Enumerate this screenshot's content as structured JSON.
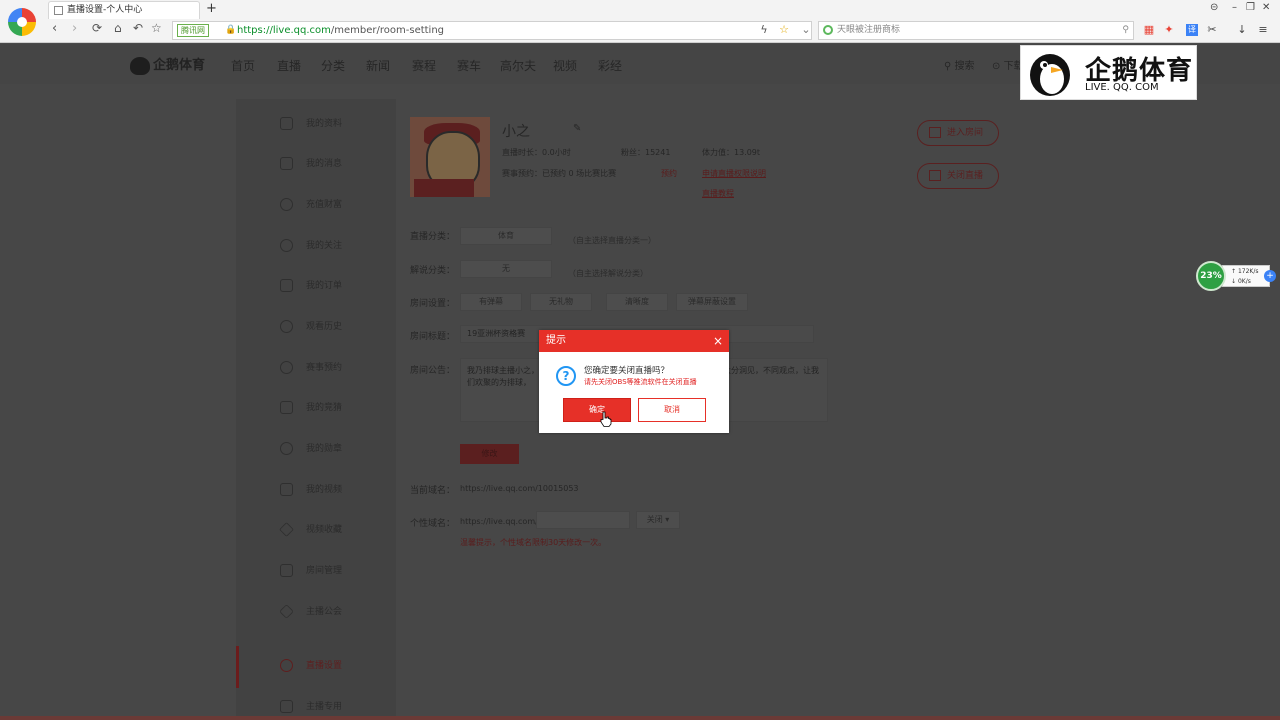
{
  "browser": {
    "tab_title": "直播设置-个人中心",
    "new_tab": "+",
    "safe_badge": "腾讯网",
    "url_host": "https://live.qq.com",
    "url_path": "/member/room-setting",
    "search_placeholder": "天眼被注册商标",
    "window_controls": [
      "⊝",
      "–",
      "❐",
      "✕"
    ],
    "toolbar_icons": [
      "bolt-icon",
      "star-icon",
      "dropdown-icon",
      "search-icon",
      "apps-icon",
      "game-icon",
      "translate-icon",
      "scissors-icon",
      "download-icon",
      "menu-icon"
    ]
  },
  "site": {
    "logo_text": "企鹅体育",
    "nav": [
      "首页",
      "直播",
      "分类",
      "新闻",
      "赛程",
      "赛车",
      "高尔夫",
      "视频",
      "彩经"
    ],
    "search_label": "搜索",
    "download_label": "下载"
  },
  "sidebar": {
    "items": [
      {
        "label": "我的资料",
        "icon": "user-icon"
      },
      {
        "label": "我的消息",
        "icon": "mail-icon"
      },
      {
        "label": "充值财富",
        "icon": "coin-icon"
      },
      {
        "label": "我的关注",
        "icon": "heart-icon"
      },
      {
        "label": "我的订单",
        "icon": "check-icon"
      },
      {
        "label": "观看历史",
        "icon": "clock-icon"
      },
      {
        "label": "赛事预约",
        "icon": "alarm-icon"
      },
      {
        "label": "我的竞猜",
        "icon": "trophy-icon"
      },
      {
        "label": "我的勋章",
        "icon": "badge-icon"
      },
      {
        "label": "我的视频",
        "icon": "play-icon"
      },
      {
        "label": "视频收藏",
        "icon": "star-icon"
      },
      {
        "label": "房间管理",
        "icon": "home-icon"
      },
      {
        "label": "主播公会",
        "icon": "diamond-icon"
      },
      {
        "label": "直播设置",
        "icon": "gear-icon",
        "active": true
      },
      {
        "label": "主播专用",
        "icon": "mic-icon"
      }
    ]
  },
  "profile": {
    "name": "小之",
    "duration": "直播时长：0.0小时",
    "fans": "粉丝：15241",
    "stamina": "体力值：13.09t",
    "appointment": "赛事预约：已预约 0 场比赛比赛",
    "cancel_appointment": "预约",
    "apply_link": "申请直播权限说明",
    "tutorial_link": "直播教程",
    "enter_room": "进入房间",
    "close_live": "关闭直播"
  },
  "form": {
    "category_label": "直播分类：",
    "category_value": "体育",
    "category_hint": "（自主选择直播分类一）",
    "commentary_label": "解说分类：",
    "commentary_value": "无",
    "commentary_hint": "（自主选择解说分类）",
    "room_settings_label": "房间设置：",
    "room_settings_options": [
      "有弹幕",
      "无礼物",
      "清晰度",
      "弹幕屏蔽设置"
    ],
    "title_label": "房间标题：",
    "title_value": "19亚洲杯资格赛",
    "notice_label": "房间公告：",
    "notice_text": "我乃排球主播小之，……中英排超联赛，以及王者教组篮球足球解说……大分洞见，不同观点，让我们欢聚的为排球，",
    "modify_button": "修改",
    "current_domain_label": "当前域名：",
    "current_domain_value": "https://live.qq.com/10015053",
    "custom_domain_label": "个性域名：",
    "custom_domain_prefix": "https://live.qq.com/",
    "custom_domain_toggle": "关闭",
    "custom_domain_warning": "温馨提示，个性域名限制30天修改一次。"
  },
  "overlay_logo": {
    "title": "企鹅体育",
    "subtitle": "LIVE. QQ. COM"
  },
  "speed_widget": {
    "percent": "23%",
    "up": "172K/s",
    "down": "0K/s",
    "plus": "+"
  },
  "dialog": {
    "title": "提示",
    "close": "×",
    "icon_glyph": "?",
    "message": "您确定要关闭直播吗？",
    "warning": "请先关闭OBS等推流软件在关闭直播",
    "confirm": "确定",
    "cancel": "取消"
  }
}
